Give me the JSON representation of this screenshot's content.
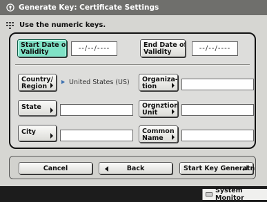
{
  "title": "Generate Key: Certificate Settings",
  "instruction": "Use the numeric keys.",
  "start_date": {
    "label_line1": "Start Date of",
    "label_line2": "Validity",
    "value": "--/--/----"
  },
  "end_date": {
    "label_line1": "End Date of",
    "label_line2": "Validity",
    "value": "--/--/----"
  },
  "country": {
    "label_line1": "Country/",
    "label_line2": "Region",
    "value": "United States (US)"
  },
  "organization": {
    "label_line1": "Organiza-",
    "label_line2": "tion",
    "value": ""
  },
  "state": {
    "label": "State",
    "value": ""
  },
  "org_unit": {
    "label_line1": "Orgnztion",
    "label_line2": "Unit",
    "value": ""
  },
  "city": {
    "label": "City",
    "value": ""
  },
  "common_name": {
    "label_line1": "Common",
    "label_line2": "Name",
    "value": ""
  },
  "buttons": {
    "cancel": "Cancel",
    "back": "Back",
    "start": "Start Key Generatn"
  },
  "system_monitor": "System Monitor",
  "colors": {
    "selected": "#7fe2c6",
    "title_bar": "#6f6f6c"
  },
  "icons": {
    "title": "lock-key-icon",
    "instruction": "keypad-icon",
    "back": "left-arrow-icon",
    "start": "enter-icon"
  }
}
